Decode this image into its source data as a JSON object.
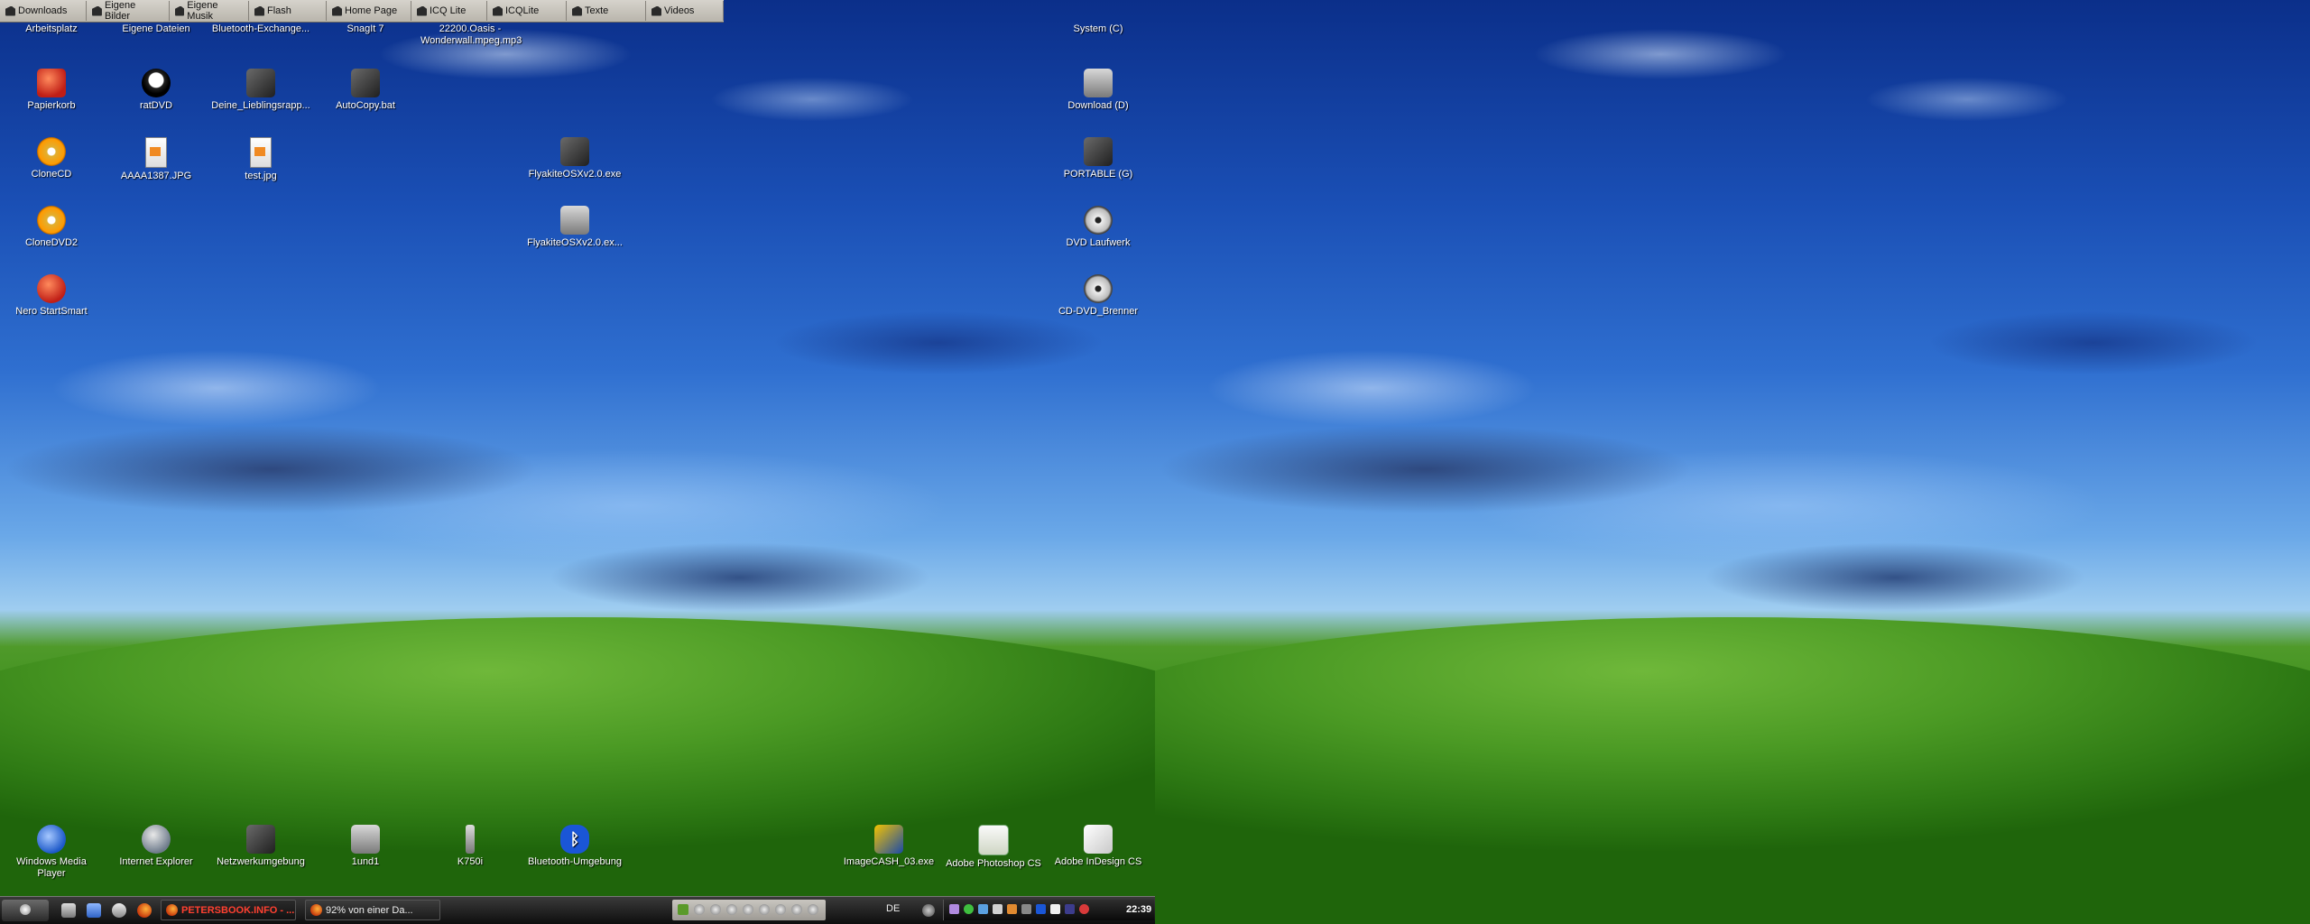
{
  "toolbar": {
    "buttons": [
      "Downloads",
      "Eigene Bilder",
      "Eigene Musik",
      "Flash",
      "Home Page",
      "ICQ Lite",
      "ICQLite",
      "Texte",
      "Videos"
    ]
  },
  "desktop": {
    "icons": {
      "arbeitsplatz": "Arbeitsplatz",
      "eigene_dateien": "Eigene Dateien",
      "bluetooth_exchange": "Bluetooth-Exchange...",
      "snagit": "SnagIt 7",
      "mp3": "22200.Oasis - Wonderwall.mpeg.mp3",
      "system_c": "System (C)",
      "papierkorb": "Papierkorb",
      "ratdvd": "ratDVD",
      "lieblingsapp": "Deine_Lieblingsrapp...",
      "autocopy": "AutoCopy.bat",
      "download_d": "Download (D)",
      "clonecd": "CloneCD",
      "aaaa_jpg": "AAAA1387.JPG",
      "test_jpg": "test.jpg",
      "flyakite_exe": "FlyakiteOSXv2.0.exe",
      "portable_g": "PORTABLE (G)",
      "clonedvd2": "CloneDVD2",
      "flyakite_ex2": "FlyakiteOSXv2.0.ex...",
      "dvd_laufwerk": "DVD Laufwerk",
      "nero": "Nero StartSmart",
      "cd_dvd": "CD-DVD_Brenner",
      "wmp": "Windows Media Player",
      "ie": "Internet Explorer",
      "netzwerk": "Netzwerkumgebung",
      "iund1": "1und1",
      "k750i": "K750i",
      "bt_umgebung": "Bluetooth-Umgebung",
      "imagecash": "ImageCASH_03.exe",
      "photoshop": "Adobe Photoshop CS",
      "indesign": "Adobe InDesign CS"
    }
  },
  "taskbar": {
    "tasks": [
      "PETERSBOOK.INFO - ...",
      "92% von einer Da..."
    ],
    "language": "DE",
    "clock": "22:39"
  },
  "colors": {
    "taskbar": "#1a1a1a",
    "task_active_text": "#ff4030",
    "sky": "#1a4fb5",
    "grass": "#3f8f1e"
  }
}
